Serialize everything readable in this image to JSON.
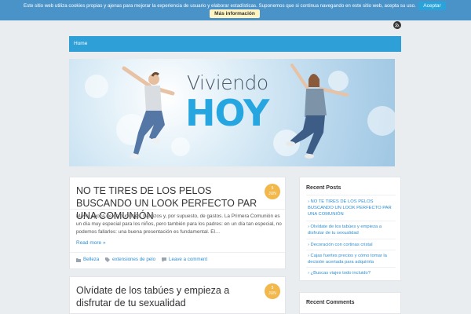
{
  "cookie": {
    "message": "Este sitio web utiliza cookies propias y ajenas para mejorar la experiencia de usuario y elaborar estadísticas. Suponemos que si continua navegando en este sitio web, acepta su uso.",
    "accept_label": "Aceptar",
    "more_label": "Más información"
  },
  "nav": {
    "home_label": "Home"
  },
  "banner": {
    "line1": "Viviendo",
    "line2": "HOY"
  },
  "posts": [
    {
      "title": "NO TE TIRES DE LOS PELOS BUSCANDO UN LOOK PERFECTO PAR UNA COMUNIÓN",
      "date_day": "5",
      "date_month": "JUN",
      "excerpt": "Mayo, época de comuniones, bautizos y, por supuesto, de gastos. La Primera Comunión es un día muy especial para los niños, pero también para los padres: en un día tan especial, no podemos fallarles: una buena presentación es fundamental. El…",
      "read_more": "Read more »",
      "category": "Belleza",
      "tag": "extensiones de pelo",
      "comment": "Leave a comment"
    },
    {
      "title": "Olvídate de los tabúes y empieza a disfrutar de tu sexualidad",
      "date_day": "5",
      "date_month": "JUN"
    }
  ],
  "sidebar": {
    "recent_posts_title": "Recent Posts",
    "recent_posts": [
      "NO TE TIRES DE LOS PELOS BUSCANDO UN LOOK PERFECTO PAR UNA COMUNIÓN",
      "Olvídate de los tabúes y empieza a disfrutar de tu sexualidad",
      "Decoración con cortinas cristal",
      "Cajas fuertes precios y cómo tomar la decisión acertada para adquirirla",
      "¿Buscas viajes todo incluido?"
    ],
    "recent_comments_title": "Recent Comments"
  },
  "colors": {
    "accent": "#2f9fd8",
    "badge": "#f2b84c",
    "cookie_bar": "#4a93c8"
  }
}
